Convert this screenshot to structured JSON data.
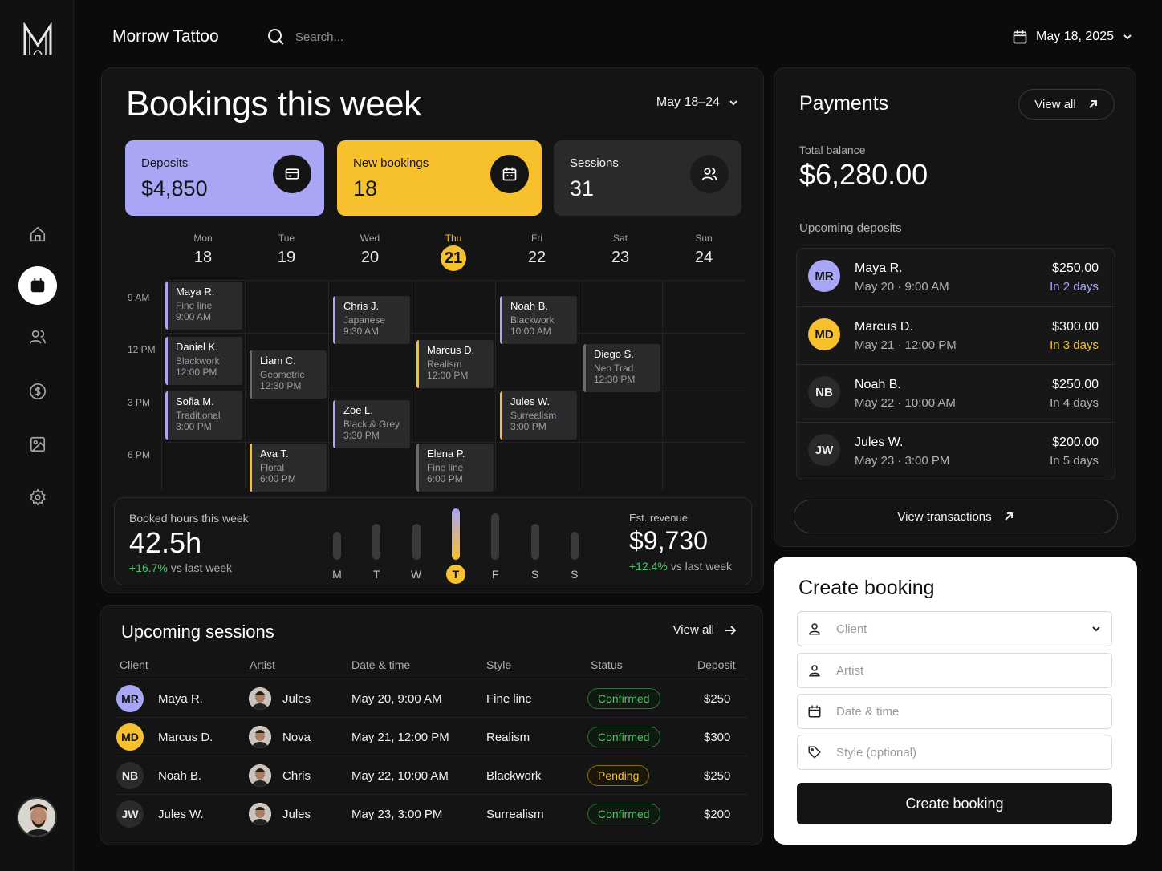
{
  "app": {
    "title": "Morrow Tattoo"
  },
  "search": {
    "placeholder": "Search..."
  },
  "topbar": {
    "date": "May 18, 2025"
  },
  "bookings": {
    "title": "Bookings this week",
    "range": "May 18–24",
    "stats": [
      {
        "label": "Deposits",
        "value": "$4,850",
        "icon": "card-icon"
      },
      {
        "label": "New bookings",
        "value": "18",
        "icon": "calendar-icon"
      },
      {
        "label": "Sessions",
        "value": "31",
        "icon": "users-icon"
      }
    ],
    "days": [
      {
        "name": "Mon",
        "date": "18"
      },
      {
        "name": "Tue",
        "date": "19"
      },
      {
        "name": "Wed",
        "date": "20"
      },
      {
        "name": "Thu",
        "date": "21",
        "today": true
      },
      {
        "name": "Fri",
        "date": "22"
      },
      {
        "name": "Sat",
        "date": "23"
      },
      {
        "name": "Sun",
        "date": "24"
      }
    ],
    "times": [
      "9 AM",
      "12 PM",
      "3 PM",
      "6 PM"
    ],
    "events": [
      {
        "client": "Maya R.",
        "style": "Fine line",
        "time": "9:00 AM",
        "day": 0,
        "color": "purple"
      },
      {
        "client": "Daniel K.",
        "style": "Blackwork",
        "time": "12:00 PM",
        "day": 0,
        "color": "purple"
      },
      {
        "client": "Sofia M.",
        "style": "Traditional",
        "time": "3:00 PM",
        "day": 0,
        "color": "purple"
      },
      {
        "client": "Liam C.",
        "style": "Geometric",
        "time": "12:30 PM",
        "day": 1,
        "color": "gray"
      },
      {
        "client": "Ava T.",
        "style": "Floral",
        "time": "6:00 PM",
        "day": 1,
        "color": "yellow"
      },
      {
        "client": "Chris J.",
        "style": "Japanese",
        "time": "9:30 AM",
        "day": 2,
        "color": "purple"
      },
      {
        "client": "Zoe L.",
        "style": "Black & Grey",
        "time": "3:30 PM",
        "day": 2,
        "color": "purple"
      },
      {
        "client": "Marcus D.",
        "style": "Realism",
        "time": "12:00 PM",
        "day": 3,
        "color": "yellow"
      },
      {
        "client": "Elena P.",
        "style": "Fine line",
        "time": "6:00 PM",
        "day": 3,
        "color": "gray"
      },
      {
        "client": "Noah B.",
        "style": "Blackwork",
        "time": "10:00 AM",
        "day": 4,
        "color": "purple"
      },
      {
        "client": "Jules W.",
        "style": "Surrealism",
        "time": "3:00 PM",
        "day": 4,
        "color": "yellow"
      },
      {
        "client": "Diego S.",
        "style": "Neo Trad",
        "time": "12:30 PM",
        "day": 5,
        "color": "gray"
      }
    ],
    "hours": {
      "label": "Booked hours this week",
      "value": "42.5h",
      "delta": "+16.7%",
      "delta_suffix": "vs last week",
      "bars": [
        {
          "day": "M",
          "level": 0.55
        },
        {
          "day": "T",
          "level": 0.7
        },
        {
          "day": "W",
          "level": 0.7
        },
        {
          "day": "T",
          "level": 1.0,
          "today": true
        },
        {
          "day": "F",
          "level": 0.9
        },
        {
          "day": "S",
          "level": 0.7
        },
        {
          "day": "S",
          "level": 0.55
        }
      ],
      "revenue_label": "Est. revenue",
      "revenue_value": "$9,730",
      "revenue_delta": "+12.4%",
      "revenue_delta_suffix": "vs last week"
    }
  },
  "sessions": {
    "title": "Upcoming sessions",
    "view_all": "View all",
    "columns": [
      "Client",
      "Artist",
      "Date & time",
      "Style",
      "Status",
      "Deposit"
    ],
    "rows": [
      {
        "initials": "MR",
        "client": "Maya R.",
        "artist": "Jules",
        "datetime": "May 20, 9:00 AM",
        "style": "Fine line",
        "status": "Confirmed",
        "deposit": "$250"
      },
      {
        "initials": "MD",
        "client": "Marcus D.",
        "artist": "Nova",
        "datetime": "May 21, 12:00 PM",
        "style": "Realism",
        "status": "Confirmed",
        "deposit": "$300"
      },
      {
        "initials": "NB",
        "client": "Noah B.",
        "artist": "Chris",
        "datetime": "May 22, 10:00 AM",
        "style": "Blackwork",
        "status": "Pending",
        "deposit": "$250"
      },
      {
        "initials": "JW",
        "client": "Jules W.",
        "artist": "Jules",
        "datetime": "May 23, 3:00 PM",
        "style": "Surrealism",
        "status": "Confirmed",
        "deposit": "$200"
      }
    ]
  },
  "payments": {
    "title": "Payments",
    "view_all": "View all",
    "total_label": "Total balance",
    "total_value": "$6,280.00",
    "upcoming_label": "Upcoming deposits",
    "deposits": [
      {
        "initials": "MR",
        "name": "Maya R.",
        "date": "May 20",
        "time": "9:00 AM",
        "amount": "$250.00",
        "due": "In 2 days"
      },
      {
        "initials": "MD",
        "name": "Marcus D.",
        "date": "May 21",
        "time": "12:00 PM",
        "amount": "$300.00",
        "due": "In 3 days"
      },
      {
        "initials": "NB",
        "name": "Noah B.",
        "date": "May 22",
        "time": "10:00 AM",
        "amount": "$250.00",
        "due": "In 4 days"
      },
      {
        "initials": "JW",
        "name": "Jules W.",
        "date": "May 23",
        "time": "3:00 PM",
        "amount": "$200.00",
        "due": "In 5 days"
      }
    ],
    "view_transactions": "View transactions"
  },
  "create": {
    "title": "Create booking",
    "client_placeholder": "Client",
    "artist_placeholder": "Artist",
    "datetime_placeholder": "Date & time",
    "style_placeholder": "Style (optional)",
    "button": "Create booking"
  },
  "colors": {
    "accent_purple": "#a9a6f5",
    "accent_yellow": "#f7c12d",
    "success": "#4ec36b",
    "background": "#0b0b0c"
  }
}
